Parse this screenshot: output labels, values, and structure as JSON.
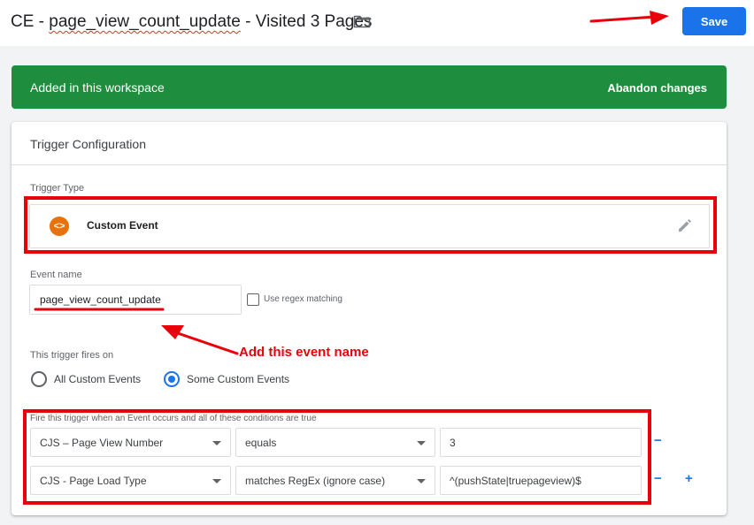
{
  "header": {
    "title_prefix": "CE - ",
    "title_misspelled": "page_view_count_update",
    "title_suffix": " - Visited 3 Pages",
    "folder_icon": "folder-icon",
    "save_label": "Save"
  },
  "banner": {
    "text": "Added in this workspace",
    "abandon_label": "Abandon changes",
    "color": "#1e8e3e"
  },
  "card": {
    "title": "Trigger Configuration",
    "trigger_type_label": "Trigger Type",
    "trigger_type_name": "Custom Event",
    "trigger_type_icon": "custom-event-icon",
    "event_name_label": "Event name",
    "event_name_value": "page_view_count_update",
    "regex_label": "Use regex matching",
    "fires_on_label": "This trigger fires on",
    "fires_on_options": [
      {
        "label": "All Custom Events",
        "selected": false
      },
      {
        "label": "Some Custom Events",
        "selected": true
      }
    ],
    "conditions_label": "Fire this trigger when an Event occurs and all of these conditions are true",
    "conditions": [
      {
        "variable": "CJS – Page View Number",
        "operator": "equals",
        "value": "3"
      },
      {
        "variable": "CJS - Page Load Type",
        "operator": "matches RegEx (ignore case)",
        "value": "^(pushState|truepageview)$"
      }
    ],
    "remove_label": "−",
    "add_label": "+"
  },
  "annotation": {
    "text": "Add this event name",
    "color": "#e8000b"
  }
}
